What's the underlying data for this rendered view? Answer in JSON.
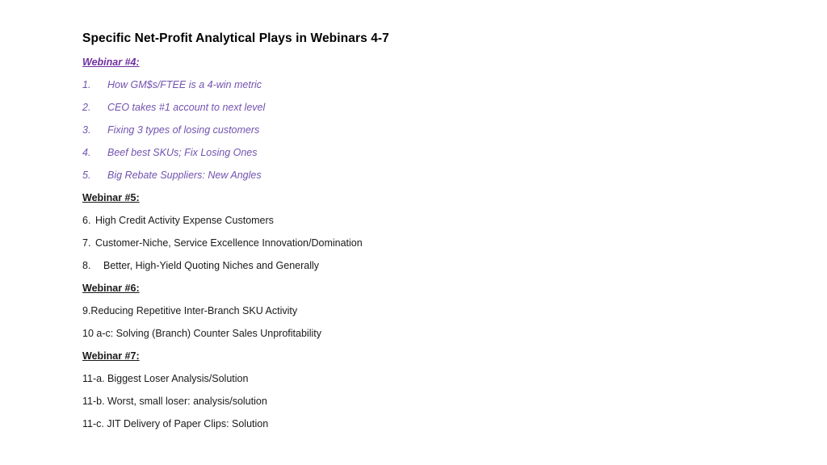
{
  "slide": {
    "title": "Specific Net-Profit Analytical Plays in Webinars 4-7",
    "colors": {
      "heading_purple": "#7030A0",
      "item_purple": "#7253B0",
      "body_black": "#1a1a1a",
      "background": "#ffffff"
    },
    "sections": [
      {
        "heading": "Webinar #4:",
        "items": [
          {
            "marker": "1.",
            "text": "How GM$s/FTEE is a 4-win metric"
          },
          {
            "marker": "2.",
            "text": "CEO takes #1 account to next level"
          },
          {
            "marker": "3.",
            "text": "Fixing 3 types of losing customers"
          },
          {
            "marker": "4.",
            "text": "Beef best SKUs; Fix Losing Ones"
          },
          {
            "marker": "5.",
            "text": "Big Rebate Suppliers: New Angles"
          }
        ]
      },
      {
        "heading": "Webinar #5:",
        "items": [
          {
            "marker": "6.",
            "text": "High Credit Activity Expense Customers"
          },
          {
            "marker": "7.",
            "text": "Customer-Niche, Service Excellence Innovation/Domination"
          },
          {
            "marker": "8.",
            "text": "Better, High-Yield Quoting Niches and Generally"
          }
        ]
      },
      {
        "heading": "Webinar #6:",
        "items": [
          {
            "text": "9.Reducing Repetitive Inter-Branch SKU Activity"
          },
          {
            "text": "10 a-c: Solving (Branch) Counter Sales Unprofitability"
          }
        ]
      },
      {
        "heading": "Webinar #7:",
        "items": [
          {
            "text": "11-a. Biggest Loser Analysis/Solution"
          },
          {
            "text": "11-b. Worst, small loser: analysis/solution"
          },
          {
            "text": "11-c. JIT Delivery of Paper Clips: Solution"
          }
        ]
      }
    ]
  }
}
